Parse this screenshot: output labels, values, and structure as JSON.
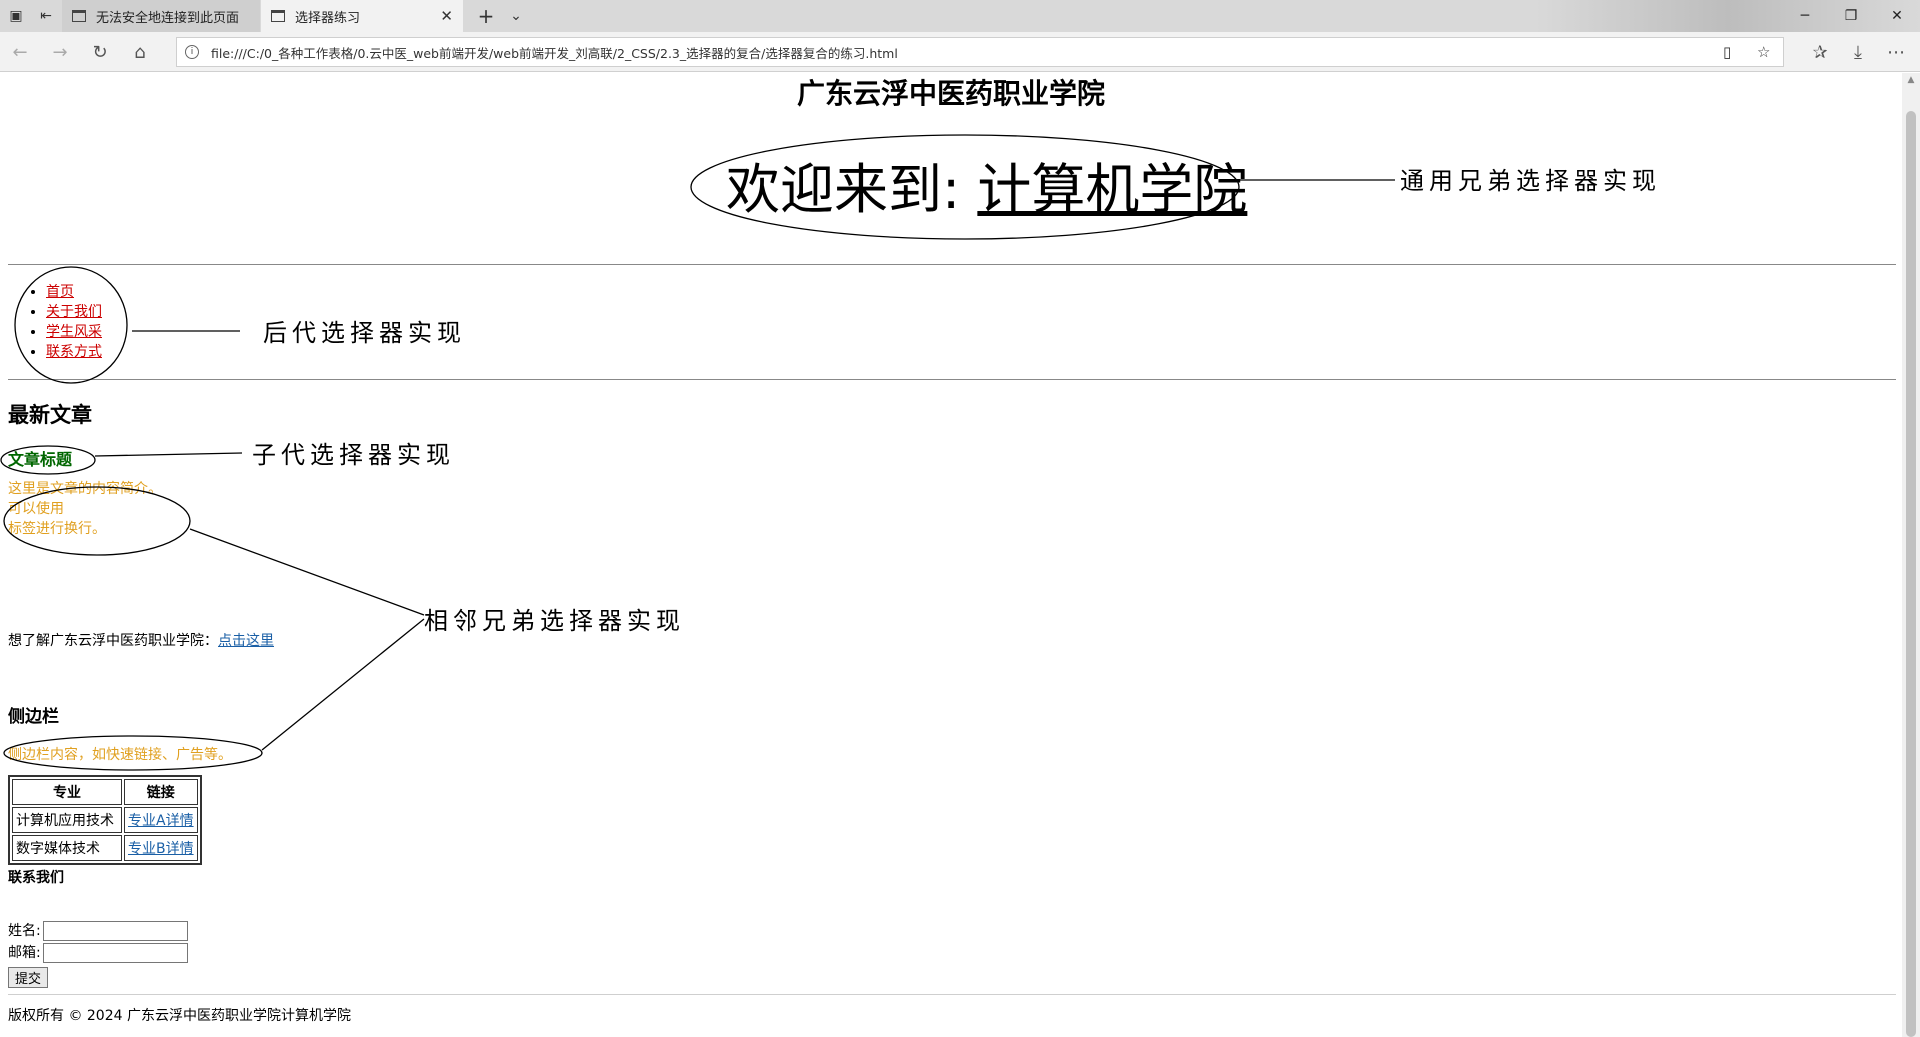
{
  "browser": {
    "tabs": [
      {
        "title": "无法安全地连接到此页面",
        "active": false
      },
      {
        "title": "选择器练习",
        "active": true
      }
    ],
    "url": "file:///C:/0_各种工作表格/0.云中医_web前端开发/web前端开发_刘高联/2_CSS/2.3_选择器的复合/选择器复合的练习.html",
    "icons": [
      "tab-preview-icon",
      "set-aside-tabs-icon",
      "back-icon",
      "forward-icon",
      "refresh-icon",
      "home-icon",
      "info-icon",
      "reading-view-icon",
      "favorite-star-icon",
      "favorites-hub-icon",
      "downloads-icon",
      "more-icon",
      "minimize-icon",
      "restore-icon",
      "close-icon"
    ]
  },
  "page": {
    "site_title": "广东云浮中医药职业学院",
    "welcome_prefix": "欢迎来到: ",
    "welcome_college": "计算机学院",
    "nav_items": [
      "首页",
      "关于我们",
      "学生风采",
      "联系方式"
    ],
    "latest_heading": "最新文章",
    "article_title": "文章标题",
    "article_intro_lines": [
      "这里是文章的内容简介。",
      "可以使用",
      "标签进行换行。"
    ],
    "learn_more_text": "想了解广东云浮中医药职业学院：",
    "learn_more_link": "点击这里",
    "sidebar_heading": "侧边栏",
    "sidebar_text": "侧边栏内容，如快速链接、广告等。",
    "table": {
      "headers": [
        "专业",
        "链接"
      ],
      "rows": [
        [
          "计算机应用技术",
          "专业A详情"
        ],
        [
          "数字媒体技术",
          "专业B详情"
        ]
      ]
    },
    "contact_heading": "联系我们",
    "form": {
      "name_label": "姓名:",
      "email_label": "邮箱:",
      "name_value": "",
      "email_value": "",
      "submit_label": "提交"
    },
    "footer": "版权所有 © 2024 广东云浮中医药职业学院计算机学院"
  },
  "annotations": {
    "general_sibling": "通用兄弟选择器实现",
    "descendant": "后代选择器实现",
    "child": "子代选择器实现",
    "adjacent_sibling": "相邻兄弟选择器实现"
  },
  "colors": {
    "nav_link": "#cc0000",
    "article_title": "#006600",
    "intro_text": "#e0a020",
    "link_blue": "#1a5fa6"
  }
}
